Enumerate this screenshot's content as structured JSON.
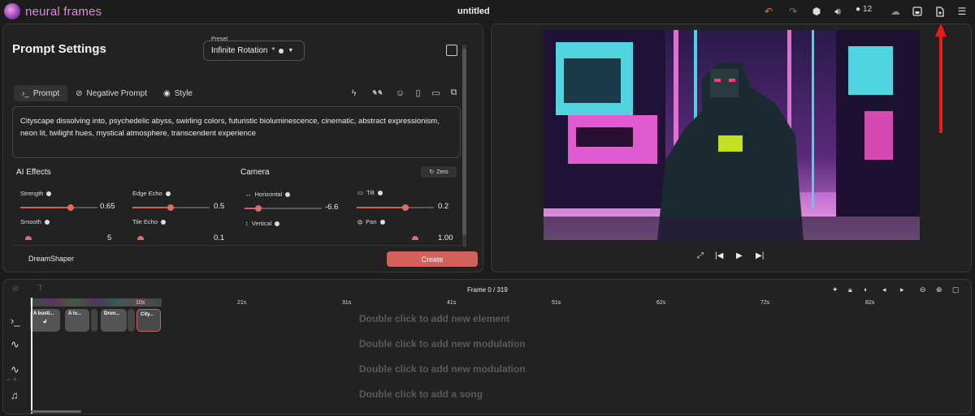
{
  "app": {
    "name": "neural frames",
    "doc_title": "untitled",
    "credits": "12"
  },
  "toolbar": {
    "icons": [
      "undo-icon",
      "redo-icon",
      "logo-hex-icon",
      "volume-icon",
      "credits-icon",
      "cloud-icon",
      "save-icon",
      "export-icon",
      "menu-icon"
    ]
  },
  "prompt_settings": {
    "title": "Prompt Settings",
    "preset_label": "Preset",
    "preset_value": "Infinite Rotation",
    "preset_mark": "*",
    "tabs": [
      {
        "label": "Prompt"
      },
      {
        "label": "Negative Prompt"
      },
      {
        "label": "Style"
      }
    ],
    "prompt_text": "Cityscape dissolving into, psychedelic abyss, swirling colors, futuristic bioluminescence, cinematic, abstract expressionism, neon lit, twilight hues, mystical atmosphere, transcendent experience",
    "ai_effects_title": "AI Effects",
    "camera_title": "Camera",
    "zero_label": "Zero",
    "controls": {
      "strength": {
        "label": "Strength",
        "value": "0.65",
        "fraction": 0.65
      },
      "edge_echo": {
        "label": "Edge Echo",
        "value": "0.5",
        "fraction": 0.5
      },
      "horizontal": {
        "label": "Horizontal",
        "value": "-6.6",
        "fraction": 0.17
      },
      "tilt": {
        "label": "Tilt",
        "value": "0.2",
        "fraction": 0.5
      },
      "smooth": {
        "label": "Smooth",
        "value": "5"
      },
      "tile_echo": {
        "label": "Tile Echo",
        "value": "0.1"
      },
      "vertical": {
        "label": "Vertical"
      },
      "pan": {
        "label": "Pan",
        "value": "1.00"
      }
    },
    "model": "DreamShaper",
    "create_label": "Create"
  },
  "timeline": {
    "frame_label": "Frame 0 / 319",
    "ticks": [
      "10s",
      "21s",
      "31s",
      "41s",
      "51s",
      "62s",
      "72s",
      "82s"
    ],
    "clips": [
      "A bustl...",
      "A lo...",
      "Dron...",
      "City..."
    ],
    "hints": [
      "Double click to add new element",
      "Double click to add new modulation",
      "Double click to add new modulation",
      "Double click to add a song"
    ]
  },
  "colors": {
    "accent": "#d4605b",
    "bg": "#1c1c1c",
    "panel": "#222222"
  }
}
